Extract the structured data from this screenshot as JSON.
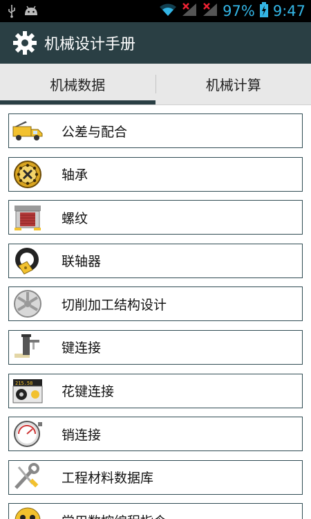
{
  "status_bar": {
    "battery": "97%",
    "time": "9:47"
  },
  "action_bar": {
    "title": "机械设计手册",
    "icon": "gear-icon"
  },
  "tabs": [
    {
      "label": "机械数据",
      "active": true
    },
    {
      "label": "机械计算",
      "active": false
    }
  ],
  "items": [
    {
      "label": "公差与配合",
      "icon": "truck-icon"
    },
    {
      "label": "轴承",
      "icon": "bearing-icon"
    },
    {
      "label": "螺纹",
      "icon": "garage-icon"
    },
    {
      "label": "联轴器",
      "icon": "tire-tag-icon"
    },
    {
      "label": "切削加工结构设计",
      "icon": "wheel-rim-icon"
    },
    {
      "label": "键连接",
      "icon": "machine-tool-icon"
    },
    {
      "label": "花键连接",
      "icon": "odometer-icon"
    },
    {
      "label": "销连接",
      "icon": "pressure-gauge-icon"
    },
    {
      "label": "工程材料数据库",
      "icon": "wrench-screwdriver-icon"
    },
    {
      "label": "常用数控编程指令",
      "icon": "mask-icon"
    }
  ],
  "colors": {
    "action_bar": "#2a3f44",
    "status_icons": "#33b5e5",
    "item_border": "#2e4a52"
  }
}
